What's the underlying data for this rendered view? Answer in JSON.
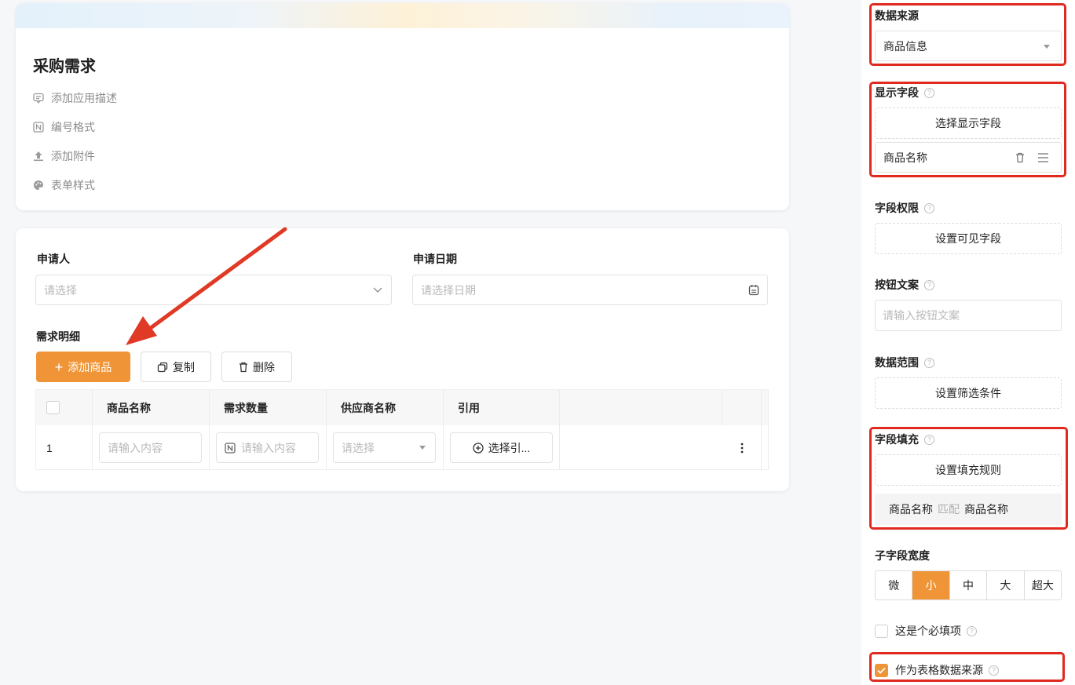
{
  "colors": {
    "accent": "#f09537",
    "highlight": "#e0291f"
  },
  "header": {
    "title": "采购需求",
    "meta": [
      {
        "icon": "comment-icon",
        "label": "添加应用描述"
      },
      {
        "icon": "number-format-icon",
        "label": "编号格式"
      },
      {
        "icon": "upload-icon",
        "label": "添加附件"
      },
      {
        "icon": "palette-icon",
        "label": "表单样式"
      }
    ]
  },
  "form": {
    "applicant": {
      "label": "申请人",
      "placeholder": "请选择"
    },
    "date": {
      "label": "申请日期",
      "placeholder": "请选择日期"
    },
    "detail": {
      "label": "需求明细",
      "add_button": "添加商品",
      "copy_button": "复制",
      "delete_button": "删除",
      "columns": [
        "商品名称",
        "需求数量",
        "供应商名称",
        "引用"
      ],
      "row": {
        "index": "1",
        "name_placeholder": "请输入内容",
        "qty_placeholder": "请输入内容",
        "supplier_placeholder": "请选择",
        "ref_button": "选择引..."
      }
    }
  },
  "panel": {
    "data_source": {
      "label": "数据来源",
      "value": "商品信息"
    },
    "display_field": {
      "label": "显示字段",
      "button": "选择显示字段",
      "item": "商品名称"
    },
    "field_permission": {
      "label": "字段权限",
      "button": "设置可见字段"
    },
    "button_text": {
      "label": "按钮文案",
      "placeholder": "请输入按钮文案"
    },
    "data_range": {
      "label": "数据范围",
      "button": "设置筛选条件"
    },
    "field_fill": {
      "label": "字段填充",
      "button": "设置填充规则",
      "rule_left": "商品名称",
      "rule_match": "匹配",
      "rule_right": "商品名称"
    },
    "subfield_width": {
      "label": "子字段宽度",
      "options": [
        "微",
        "小",
        "中",
        "大",
        "超大"
      ],
      "selected": "小"
    },
    "required": {
      "label": "这是个必填项"
    },
    "as_table_source": {
      "label": "作为表格数据来源"
    }
  }
}
